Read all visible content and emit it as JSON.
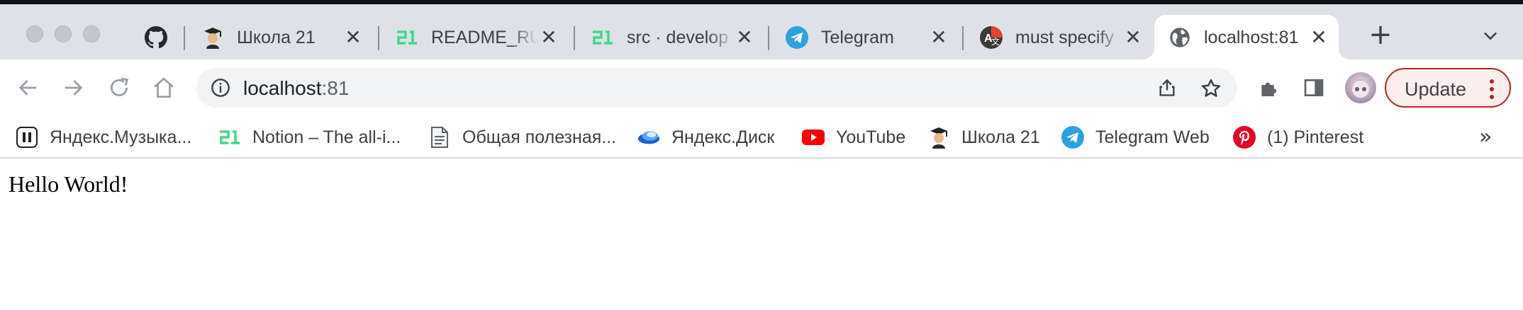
{
  "tabs": [
    {
      "title": "",
      "icon": "github-icon"
    },
    {
      "title": "Школа 21",
      "icon": "school21-icon"
    },
    {
      "title": "README_RU",
      "icon": "school21-logo-icon"
    },
    {
      "title": "src · develop",
      "icon": "school21-logo-icon"
    },
    {
      "title": "Telegram",
      "icon": "telegram-icon"
    },
    {
      "title": "must specify",
      "icon": "translate-icon"
    },
    {
      "title": "localhost:81",
      "icon": "globe-icon",
      "active": true
    }
  ],
  "toolbar": {
    "url_host": "localhost",
    "url_port": ":81",
    "update_label": "Update"
  },
  "bookmarks": [
    {
      "label": "Яндекс.Музыка...",
      "icon": "pause-icon"
    },
    {
      "label": "Notion – The all-i...",
      "icon": "school21-logo-icon"
    },
    {
      "label": "Общая полезная...",
      "icon": "document-icon"
    },
    {
      "label": "Яндекс.Диск",
      "icon": "yandex-disk-icon"
    },
    {
      "label": "YouTube",
      "icon": "youtube-icon"
    },
    {
      "label": "Школа 21",
      "icon": "school21-icon"
    },
    {
      "label": "Telegram Web",
      "icon": "telegram-icon"
    },
    {
      "label": "(1) Pinterest",
      "icon": "pinterest-icon"
    }
  ],
  "bookmarks_more": "»",
  "page": {
    "heading": "Hello World!"
  },
  "colors": {
    "tabstrip": "#dee1e6",
    "omnibox": "#f1f3f4",
    "update_border": "#b3261e",
    "school21_green": "#3fd98c",
    "telegram_blue": "#2aa3df",
    "youtube_red": "#ff0000",
    "pinterest_red": "#e60023"
  }
}
